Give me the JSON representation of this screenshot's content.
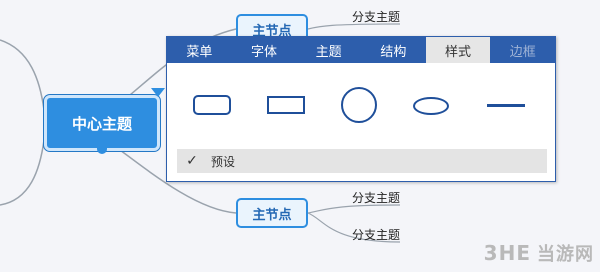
{
  "mindmap": {
    "central_topic": "中心主题",
    "main_nodes": [
      "主节点",
      "主节点"
    ],
    "sub_topics": [
      "分支主题",
      "分支主题",
      "分支主题"
    ]
  },
  "panel": {
    "tabs": [
      {
        "label": "菜单",
        "state": "normal"
      },
      {
        "label": "字体",
        "state": "normal"
      },
      {
        "label": "主题",
        "state": "normal"
      },
      {
        "label": "结构",
        "state": "normal"
      },
      {
        "label": "样式",
        "state": "active"
      },
      {
        "label": "边框",
        "state": "disabled"
      }
    ],
    "shapes": [
      "rounded-rectangle",
      "rectangle",
      "circle",
      "ellipse",
      "line"
    ],
    "preset_label": "预设",
    "preset_icon": "✓"
  },
  "watermark": {
    "logo": "3HE",
    "text": "当游网"
  },
  "colors": {
    "accent": "#2e8ee0",
    "panel_header": "#2d5eac",
    "shape_stroke": "#1f4f9a"
  }
}
